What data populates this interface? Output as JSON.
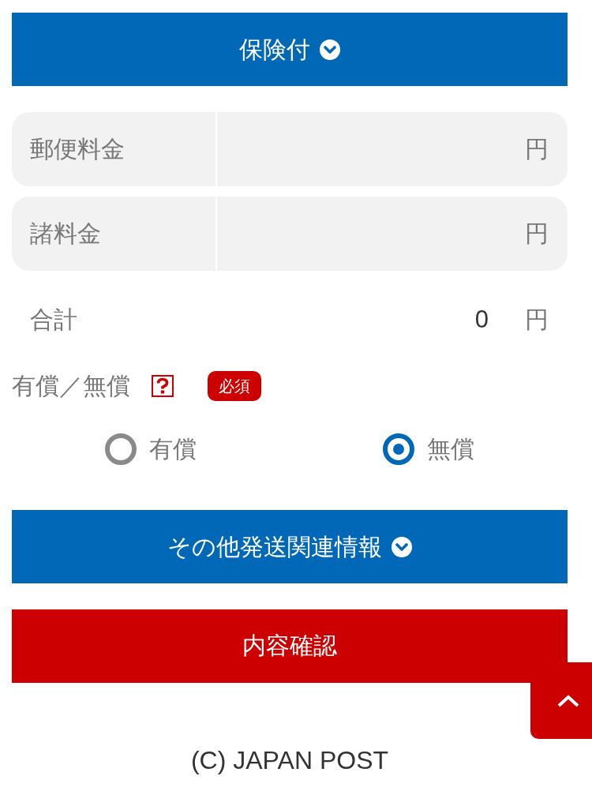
{
  "insurance_toggle": {
    "label": "保険付",
    "expanded": false
  },
  "fee_fields": [
    {
      "label": "郵便料金",
      "unit": "円"
    },
    {
      "label": "諸料金",
      "unit": "円"
    }
  ],
  "total": {
    "label": "合計",
    "value": "0",
    "unit": "円"
  },
  "payment_type": {
    "label": "有償／無償",
    "required_badge": "必須",
    "options": [
      {
        "label": "有償",
        "selected": false
      },
      {
        "label": "無償",
        "selected": true
      }
    ]
  },
  "other_info_toggle": {
    "label": "その他発送関連情報",
    "expanded": false
  },
  "confirm_button": {
    "label": "内容確認"
  },
  "footer": {
    "copyright": "(C) JAPAN POST"
  }
}
